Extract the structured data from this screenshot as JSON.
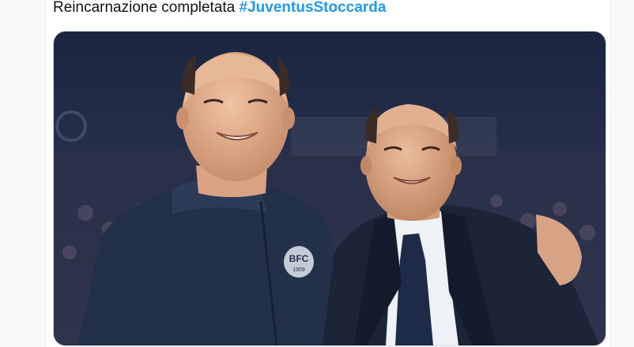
{
  "tweet": {
    "text": "Reincarnazione completata ",
    "hashtag": "#JuventusStoccarda"
  },
  "media": {
    "badge_text": "BFC",
    "badge_year": "1909",
    "icons": [
      "photo"
    ]
  },
  "colors": {
    "hashtag": "#1d9bf0",
    "text": "#0f1419",
    "background": "#f7f9f9"
  }
}
